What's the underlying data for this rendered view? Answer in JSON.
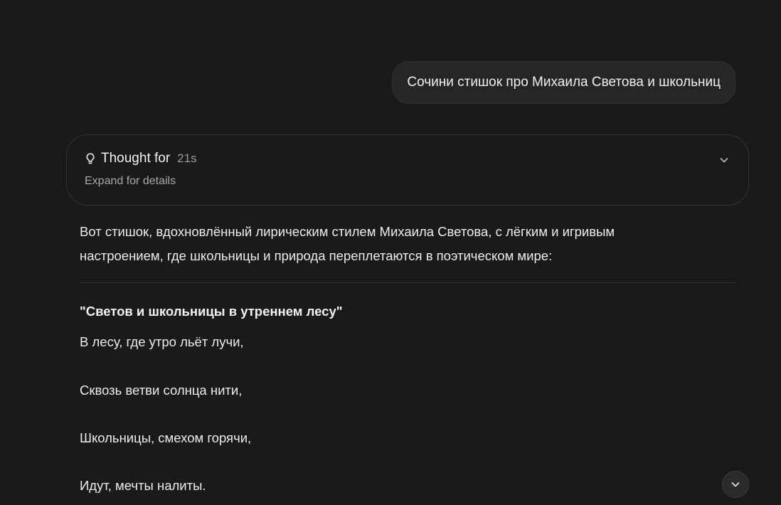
{
  "user_message": {
    "text": "Сочини стишок про Михаила Светова и школьниц"
  },
  "thought": {
    "title": "Thought for",
    "duration": "21s",
    "subtitle": "Expand for details",
    "icon": "lightbulb-icon",
    "toggle_icon": "chevron-down-icon"
  },
  "answer": {
    "intro_line1": "Вот стишок, вдохновлённый лирическим стилем Михаила Светова, с лёгким и игривым",
    "intro_line2": "настроением, где школьницы и природа переплетаются в поэтическом мире:",
    "poem_title": "\"Светов и школьницы в утреннем лесу\"",
    "poem_lines": [
      "В лесу, где утро льёт лучи,",
      "Сквозь ветви солнца нити,",
      "Школьницы, смехом горячи,",
      "Идут, мечты налиты."
    ]
  },
  "scroll_button": {
    "icon": "chevron-down-icon"
  },
  "colors": {
    "background": "#1a1a1c",
    "bubble": "#262628",
    "border": "#333336",
    "text": "#ececec",
    "muted": "#a8a8ab"
  }
}
